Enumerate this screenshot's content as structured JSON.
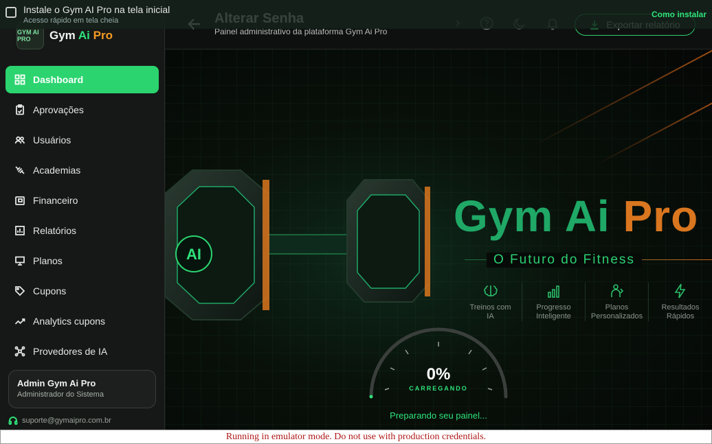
{
  "install_banner": {
    "title": "Instale o Gym AI Pro na tela inicial",
    "subtitle": "Acesso rápido em tela cheia",
    "action": "Como instalar"
  },
  "brand": {
    "logo_text": "GYM AI PRO",
    "name_gym": "Gym ",
    "name_ai": "Ai",
    "name_pro": " Pro"
  },
  "sidebar": {
    "items": [
      {
        "label": "Dashboard",
        "icon": "dashboard-icon",
        "active": true
      },
      {
        "label": "Aprovações",
        "icon": "clipboard-icon"
      },
      {
        "label": "Usuários",
        "icon": "users-icon"
      },
      {
        "label": "Academias",
        "icon": "dumbbell-icon"
      },
      {
        "label": "Financeiro",
        "icon": "wallet-icon"
      },
      {
        "label": "Relatórios",
        "icon": "bar-chart-icon"
      },
      {
        "label": "Planos",
        "icon": "monitor-icon"
      },
      {
        "label": "Cupons",
        "icon": "tag-icon"
      },
      {
        "label": "Analytics cupons",
        "icon": "analytics-icon"
      },
      {
        "label": "Provedores de IA",
        "icon": "network-icon"
      }
    ],
    "user": {
      "name": "Admin Gym Ai Pro",
      "role": "Administrador do Sistema"
    },
    "support_email": "suporte@gymaipro.com.br"
  },
  "header": {
    "title": "Alterar Senha",
    "subtitle": "Painel administrativo da plataforma Gym Ai Pro",
    "export_label": "Exportar relatório"
  },
  "splash": {
    "hero_gym": "Gym Ai ",
    "hero_pro": "Pro",
    "tagline": "O Futuro do Fitness",
    "badge_text": "AI",
    "features": [
      {
        "line1": "Treinos com",
        "line2": "IA",
        "icon": "brain-icon"
      },
      {
        "line1": "Progresso",
        "line2": "Inteligente",
        "icon": "bars-icon"
      },
      {
        "line1": "Planos",
        "line2": "Personalizados",
        "icon": "coach-icon"
      },
      {
        "line1": "Resultados",
        "line2": "Rápidos",
        "icon": "bolt-icon"
      }
    ],
    "progress_percent": 0,
    "percent_label": "0%",
    "loading_label": "CARREGANDO",
    "status": "Preparando seu painel..."
  },
  "emulator_notice": "Running in emulator mode. Do not use with production credentials.",
  "colors": {
    "accent": "#2bd46f",
    "brand_orange": "#f59a23",
    "background": "#0b0d0c"
  }
}
